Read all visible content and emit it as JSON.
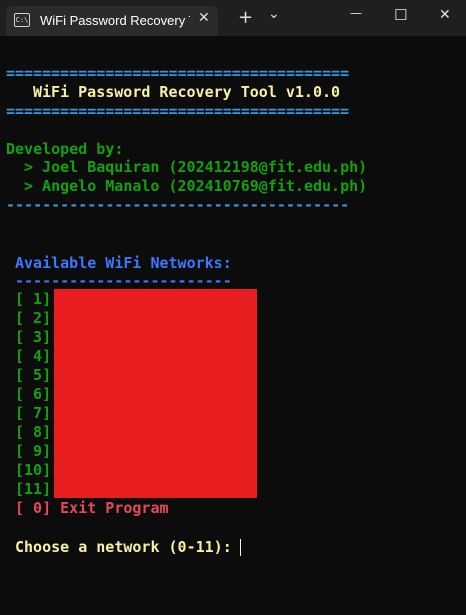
{
  "window": {
    "tab_title": "WiFi Password Recovery T",
    "tab_icon_text": "C:\\",
    "buttons": {
      "close_tab": "✕",
      "new_tab": "+",
      "dropdown": "⌄",
      "minimize": "—",
      "maximize": "☐",
      "close": "✕"
    }
  },
  "terminal": {
    "rule_double": "======================================",
    "title": "WiFi Password Recovery Tool v1.0.0",
    "developed_by": "Developed by:",
    "devs": [
      "> Joel Baquiran (202412198@fit.edu.ph)",
      "> Angelo Manalo (202410769@fit.edu.ph)"
    ],
    "rule_single": "--------------------------------------",
    "networks_heading": "Available WiFi Networks:",
    "networks_rule": "------------------------",
    "network_indices": [
      "[ 1]",
      "[ 2]",
      "[ 3]",
      "[ 4]",
      "[ 5]",
      "[ 6]",
      "[ 7]",
      "[ 8]",
      "[ 9]",
      "[10]",
      "[11]"
    ],
    "exit_option": "[ 0] Exit Program",
    "prompt": "Choose a network (0-11):"
  },
  "colors": {
    "background": "#0c0c0c",
    "cyan": "#3a96dd",
    "yellow": "#f9f1a5",
    "green": "#13a10e",
    "blue": "#3b78ff",
    "red": "#e74856",
    "redaction": "#e81e1e"
  }
}
